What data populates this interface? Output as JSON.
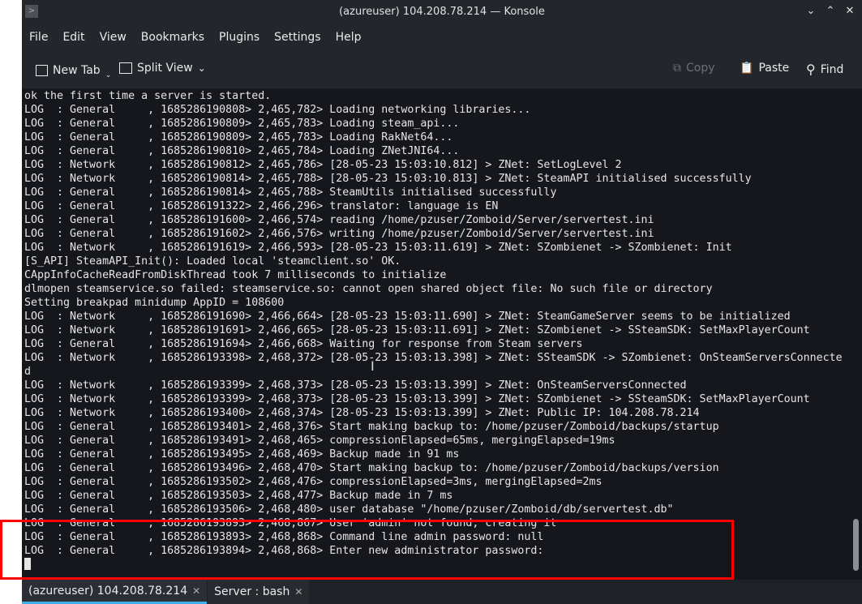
{
  "window": {
    "title": "(azureuser) 104.208.78.214 — Konsole"
  },
  "menu": [
    "File",
    "Edit",
    "View",
    "Bookmarks",
    "Plugins",
    "Settings",
    "Help"
  ],
  "toolbar": {
    "new_tab": "New Tab",
    "split_view": "Split View",
    "copy": "Copy",
    "paste": "Paste",
    "find": "Find"
  },
  "terminal": {
    "lines": [
      "ok the first time a server is started.",
      "LOG  : General     , 1685286190808> 2,465,782> Loading networking libraries...",
      "LOG  : General     , 1685286190809> 2,465,783> Loading steam_api...",
      "LOG  : General     , 1685286190809> 2,465,783> Loading RakNet64...",
      "LOG  : General     , 1685286190810> 2,465,784> Loading ZNetJNI64...",
      "LOG  : Network     , 1685286190812> 2,465,786> [28-05-23 15:03:10.812] > ZNet: SetLogLevel 2",
      "LOG  : Network     , 1685286190814> 2,465,788> [28-05-23 15:03:10.813] > ZNet: SteamAPI initialised successfully",
      "LOG  : General     , 1685286190814> 2,465,788> SteamUtils initialised successfully",
      "LOG  : General     , 1685286191322> 2,466,296> translator: language is EN",
      "LOG  : General     , 1685286191600> 2,466,574> reading /home/pzuser/Zomboid/Server/servertest.ini",
      "LOG  : General     , 1685286191602> 2,466,576> writing /home/pzuser/Zomboid/Server/servertest.ini",
      "LOG  : Network     , 1685286191619> 2,466,593> [28-05-23 15:03:11.619] > ZNet: SZombienet -> SZombienet: Init",
      "[S_API] SteamAPI_Init(): Loaded local 'steamclient.so' OK.",
      "CAppInfoCacheReadFromDiskThread took 7 milliseconds to initialize",
      "dlmopen steamservice.so failed: steamservice.so: cannot open shared object file: No such file or directory",
      "Setting breakpad minidump AppID = 108600",
      "LOG  : Network     , 1685286191690> 2,466,664> [28-05-23 15:03:11.690] > ZNet: SteamGameServer seems to be initialized",
      "LOG  : Network     , 1685286191691> 2,466,665> [28-05-23 15:03:11.691] > ZNet: SZombienet -> SSteamSDK: SetMaxPlayerCount",
      "LOG  : General     , 1685286191694> 2,466,668> Waiting for response from Steam servers",
      "LOG  : Network     , 1685286193398> 2,468,372> [28-05-23 15:03:13.398] > ZNet: SSteamSDK -> SZombienet: OnSteamServersConnecte",
      "d",
      "LOG  : Network     , 1685286193399> 2,468,373> [28-05-23 15:03:13.399] > ZNet: OnSteamServersConnected",
      "LOG  : Network     , 1685286193399> 2,468,373> [28-05-23 15:03:13.399] > ZNet: SZombienet -> SSteamSDK: SetMaxPlayerCount",
      "LOG  : Network     , 1685286193400> 2,468,374> [28-05-23 15:03:13.399] > ZNet: Public IP: 104.208.78.214",
      "LOG  : General     , 1685286193401> 2,468,376> Start making backup to: /home/pzuser/Zomboid/backups/startup",
      "LOG  : General     , 1685286193491> 2,468,465> compressionElapsed=65ms, mergingElapsed=19ms",
      "LOG  : General     , 1685286193495> 2,468,469> Backup made in 91 ms",
      "LOG  : General     , 1685286193496> 2,468,470> Start making backup to: /home/pzuser/Zomboid/backups/version",
      "LOG  : General     , 1685286193502> 2,468,476> compressionElapsed=3ms, mergingElapsed=2ms",
      "LOG  : General     , 1685286193503> 2,468,477> Backup made in 7 ms",
      "LOG  : General     , 1685286193506> 2,468,480> user database \"/home/pzuser/Zomboid/db/servertest.db\"",
      "LOG  : General     , 1685286193893> 2,468,867> User 'admin' not found, creating it",
      "LOG  : General     , 1685286193893> 2,468,868> Command line admin password: null",
      "LOG  : General     , 1685286193894> 2,468,868> Enter new administrator password:"
    ]
  },
  "tabs": [
    {
      "label": "(azureuser) 104.208.78.214"
    },
    {
      "label": "Server : bash"
    }
  ]
}
